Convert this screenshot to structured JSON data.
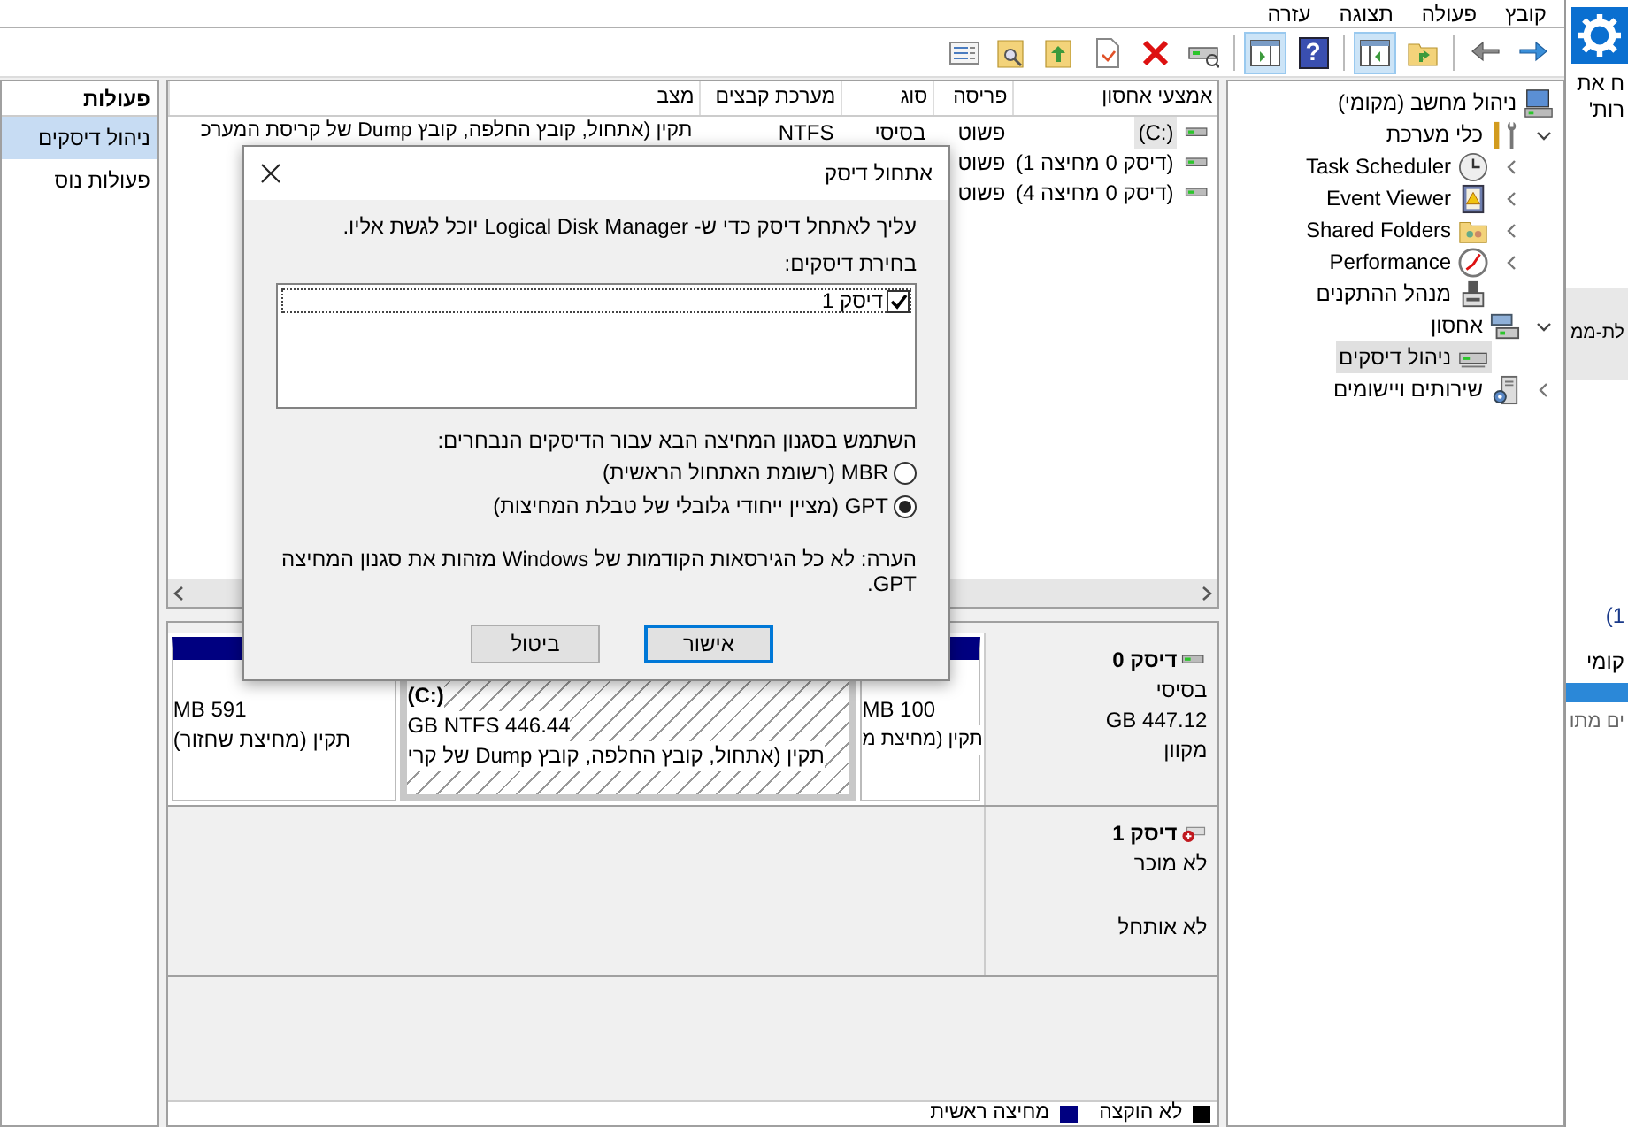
{
  "menu": [
    "קובץ",
    "פעולה",
    "תצוגה",
    "עזרה"
  ],
  "toolbar": [
    {
      "kind": "forward",
      "pressed": false
    },
    {
      "kind": "back",
      "pressed": false
    },
    {
      "kind": "separator"
    },
    {
      "kind": "folder_up",
      "pressed": false
    },
    {
      "kind": "tree_pane",
      "pressed": true
    },
    {
      "kind": "separator"
    },
    {
      "kind": "help",
      "glyph": "?",
      "pressed": false
    },
    {
      "kind": "action_pane",
      "pressed": true
    },
    {
      "kind": "separator"
    },
    {
      "kind": "disk",
      "pressed": false
    },
    {
      "kind": "delete",
      "pressed": false
    },
    {
      "kind": "check_doc",
      "pressed": false
    },
    {
      "kind": "folder_arrow",
      "pressed": false
    },
    {
      "kind": "folder_search",
      "pressed": false
    },
    {
      "kind": "properties",
      "pressed": false
    }
  ],
  "tree": {
    "items": [
      {
        "label": "ניהול מחשב (מקומי)",
        "kind": "computer",
        "selected": false,
        "children": [
          {
            "label": "כלי מערכת",
            "kind": "tools",
            "expanded": true,
            "selected": false,
            "children": [
              {
                "label": "Task Scheduler",
                "kind": "clock",
                "expanded": false,
                "selected": false
              },
              {
                "label": "Event Viewer",
                "kind": "log",
                "expanded": false,
                "selected": false
              },
              {
                "label": "Shared Folders",
                "kind": "folder",
                "expanded": false,
                "selected": false
              },
              {
                "label": "Performance",
                "kind": "gauge",
                "expanded": false,
                "selected": false
              },
              {
                "label": "מנהל ההתקנים",
                "kind": "device",
                "selected": false
              }
            ]
          },
          {
            "label": "אחסון",
            "kind": "storage",
            "expanded": true,
            "selected": false,
            "children": [
              {
                "label": "ניהול דיסקים",
                "kind": "disk",
                "selected": true
              }
            ]
          },
          {
            "label": "שירותים ויישומים",
            "kind": "services",
            "expanded": false,
            "selected": false
          }
        ]
      }
    ]
  },
  "volumes": {
    "columns": [
      "אמצעי אחסון",
      "פריסה",
      "סוג",
      "מערכת קבצים",
      "מצב"
    ],
    "rows": [
      {
        "selected": true,
        "cells": [
          "(C:)",
          "פשוט",
          "בסיסי",
          "NTFS",
          "תקין (אתחול, קובץ החלפה, קובץ Dump של קריסת המערכ"
        ]
      },
      {
        "selected": false,
        "cells": [
          "(דיסק 0 מחיצה 1)",
          "פשוט"
        ]
      },
      {
        "selected": false,
        "cells": [
          "(דיסק 0 מחיצה 4)",
          "פשוט"
        ]
      }
    ]
  },
  "disks": [
    {
      "name": "דיסק 0",
      "kind": "online",
      "details": [
        "בסיסי",
        "GB 447.12",
        "מקוון"
      ],
      "partitions": [
        {
          "kind": "primary",
          "selected": false,
          "lines": [
            "MB 100",
            "תקין (מחיצת מ"
          ]
        },
        {
          "kind": "primary",
          "selected": true,
          "title": "(C:)",
          "lines": [
            "GB NTFS 446.44",
            "תקין (אתחול, קובץ החלפה, קובץ Dump של קרי"
          ]
        },
        {
          "kind": "primary",
          "selected": false,
          "lines": [
            "MB 591",
            "תקין (מחיצת שחזור)"
          ]
        }
      ]
    },
    {
      "name": "דיסק 1",
      "kind": "not_initialized",
      "details": [
        "לא מוכר"
      ],
      "note": "לא אותחל"
    }
  ],
  "legend": [
    {
      "label": "לא הוקצה",
      "color": "#000000"
    },
    {
      "label": "מחיצה ראשית",
      "color": "#000080"
    }
  ],
  "actions": {
    "title": "פעולות",
    "items": [
      {
        "label": "ניהול דיסקים",
        "selected": true
      },
      {
        "label": "פעולות נוס",
        "selected": false
      }
    ]
  },
  "dialog": {
    "title": "אתחול דיסק",
    "message": "עליך לאתחל דיסק כדי ש- Logical Disk Manager יוכל לגשת אליו.",
    "list_label": "בחירת דיסקים:",
    "disks": [
      {
        "label": "דיסק 1",
        "checked": true
      }
    ],
    "style_label": "השתמש בסגנון המחיצה הבא עבור הדיסקים הנבחרים:",
    "options": [
      {
        "label": "MBR (רשומת האתחול הראשית)",
        "selected": false
      },
      {
        "label": "GPT (מציין ייחודי גלובלי של טבלת המחיצות)",
        "selected": true
      }
    ],
    "note": "הערה: לא כל הגירסאות הקודמות של Windows מזהות את סגנון המחיצה GPT.",
    "buttons": [
      {
        "label": "אישור",
        "default": true
      },
      {
        "label": "ביטול",
        "default": false
      }
    ]
  },
  "background_window": {
    "top_lines": [
      "ח את",
      "רות'"
    ],
    "band_text": "לת-ממ",
    "lower_lines": [
      "(1",
      "קומי"
    ],
    "bottom_line": "ים מתו"
  }
}
